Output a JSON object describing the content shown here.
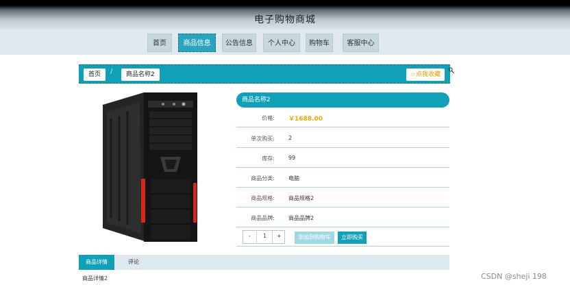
{
  "header": {
    "title": "电子购物商城"
  },
  "nav": [
    {
      "label": "首页",
      "active": false
    },
    {
      "label": "商品信息",
      "active": true
    },
    {
      "label": "公告信息",
      "active": false
    },
    {
      "label": "个人中心",
      "active": false
    },
    {
      "label": "购物车",
      "active": false
    },
    {
      "label": "客服中心",
      "active": false
    }
  ],
  "breadcrumb": {
    "home": "首页",
    "separator": "/",
    "current": "商品名称2"
  },
  "favorite_label": "☆点我收藏",
  "product": {
    "name": "商品名称2",
    "rows": [
      {
        "key": "价格:",
        "value": "￥1688.00"
      },
      {
        "key": "单次购买:",
        "value": "2"
      },
      {
        "key": "库存:",
        "value": "99"
      },
      {
        "key": "商品分类:",
        "value": "电脑"
      },
      {
        "key": "商品规格:",
        "value": "商品规格2"
      },
      {
        "key": "商品品牌:",
        "value": "商品品牌2"
      }
    ],
    "quantity": {
      "minus": "-",
      "value": "1",
      "plus": "+"
    },
    "add_to_cart_label": "添加到购物车",
    "buy_label": "立即购买"
  },
  "tabs": [
    {
      "label": "商品详情"
    },
    {
      "label": "评论"
    }
  ],
  "detail_text": "商品详情2",
  "watermark": "CSDN @sheji 198",
  "colors": {
    "accent": "#10a0b8",
    "price": "#f0a800"
  }
}
